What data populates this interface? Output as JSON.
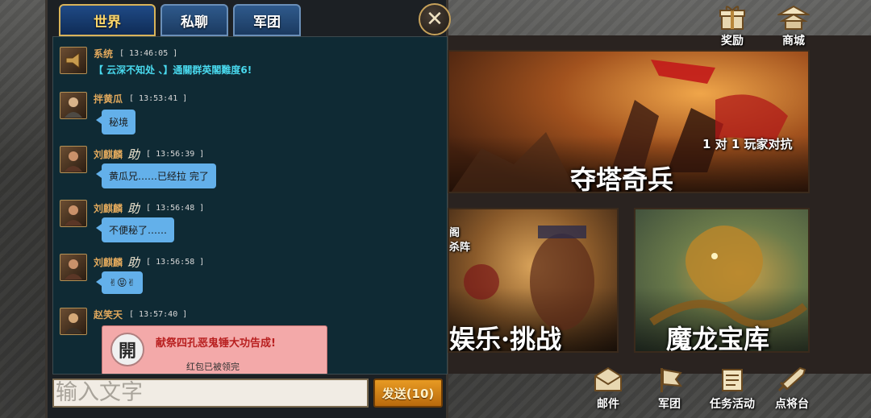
{
  "tabs": {
    "world": "世界",
    "private": "私聊",
    "legion": "军团"
  },
  "close_glyph": "✕",
  "messages": [
    {
      "sender": "系统",
      "time": "[ 13:46:05 ]",
      "text": "【 云深不知处 、】通關群英閣難度6!",
      "kind": "system"
    },
    {
      "sender": "拌黄瓜",
      "time": "[ 13:53:41 ]",
      "text": "秘境",
      "kind": "chat"
    },
    {
      "sender": "刘麒麟",
      "helper": "助",
      "time": "[ 13:56:39 ]",
      "text": "黄瓜兄……已经拉 完了",
      "kind": "chat"
    },
    {
      "sender": "刘麒麟",
      "helper": "助",
      "time": "[ 13:56:48 ]",
      "text": "不便秘了……",
      "kind": "chat"
    },
    {
      "sender": "刘麒麟",
      "helper": "助",
      "time": "[ 13:56:58 ]",
      "text": "✌😝✌",
      "kind": "chat"
    },
    {
      "sender": "赵笑天",
      "time": "[ 13:57:40 ]",
      "kind": "redpacket",
      "seal": "開",
      "title": "献祭四孔恶鬼锤大功告成!",
      "status": "红包已被领完"
    }
  ],
  "input": {
    "placeholder": "输入文字"
  },
  "send_button": "发送(10)",
  "top_menu": {
    "rewards": "奖励",
    "shop": "商城"
  },
  "cards": {
    "tower": {
      "title": "夺塔奇兵",
      "subtitle": "1 对 1 玩家对抗"
    },
    "entertainment": {
      "title": "娱乐·挑战",
      "corner_text_1": "阁",
      "corner_text_2": "杀阵"
    },
    "dragon": {
      "title": "魔龙宝库"
    }
  },
  "bottom_menu": {
    "mail": "邮件",
    "legion": "军团",
    "quests": "任务活动",
    "generals": "点将台"
  },
  "colors": {
    "bubble": "#63b0ea",
    "system_text": "#49d9ee",
    "sender": "#e0a85c",
    "send_button": "#e79a23",
    "redpacket": "#f3a9a9"
  },
  "icons": [
    "shield-icon",
    "close-icon",
    "gift-icon",
    "pagoda-icon",
    "mail-icon",
    "banner-icon",
    "scroll-icon",
    "sword-icon"
  ]
}
